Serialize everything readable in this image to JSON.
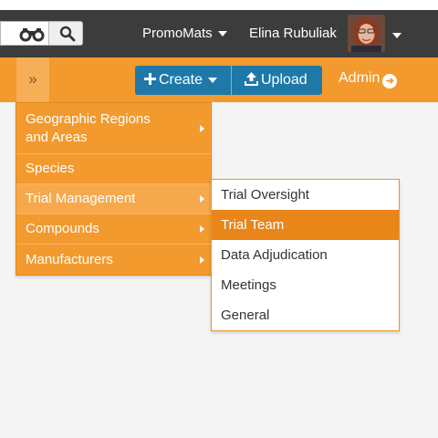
{
  "colors": {
    "topbar": "#3c3c3c",
    "navbar": "#f29a2e",
    "button_blue": "#1f79a8",
    "menu_active": "#f6a94c",
    "submenu_active": "#e8861a"
  },
  "header": {
    "search_icon": "binoculars-icon",
    "search_button_icon": "magnifier-icon",
    "app_name": "PromoMats",
    "user_name": "Elina Rubuliak"
  },
  "navbar": {
    "toggle_label": "»",
    "create_label": "Create",
    "upload_label": "Upload",
    "admin_label": "Admin"
  },
  "menu": {
    "items": [
      {
        "label": "Geographic Regions and Areas",
        "has_submenu": true
      },
      {
        "label": "Species",
        "has_submenu": false
      },
      {
        "label": "Trial Management",
        "has_submenu": true,
        "active": true
      },
      {
        "label": "Compounds",
        "has_submenu": true
      },
      {
        "label": "Manufacturers",
        "has_submenu": true
      }
    ]
  },
  "submenu": {
    "items": [
      {
        "label": "Trial Oversight"
      },
      {
        "label": "Trial Team",
        "active": true
      },
      {
        "label": "Data Adjudication"
      },
      {
        "label": "Meetings"
      },
      {
        "label": "General"
      }
    ]
  }
}
